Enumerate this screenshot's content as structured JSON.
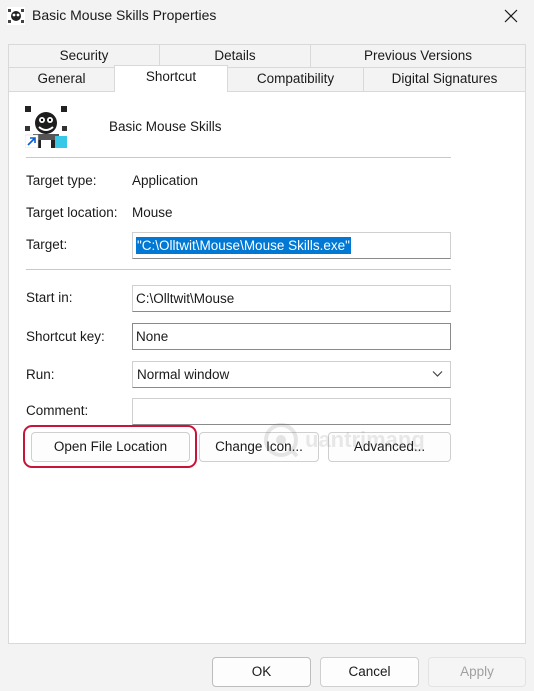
{
  "window": {
    "title": "Basic Mouse Skills Properties",
    "close_symbol": "✕"
  },
  "tabs": {
    "row1": [
      "Security",
      "Details",
      "Previous Versions"
    ],
    "row2": [
      "General",
      "Shortcut",
      "Compatibility",
      "Digital Signatures"
    ],
    "selected": "Shortcut"
  },
  "shortcut": {
    "name": "Basic Mouse Skills",
    "target_type_label": "Target type:",
    "target_type": "Application",
    "target_location_label": "Target location:",
    "target_location": "Mouse",
    "target_label": "Target:",
    "target_value": "\"C:\\Olltwit\\Mouse\\Mouse Skills.exe\"",
    "start_in_label": "Start in:",
    "start_in_value": "C:\\Olltwit\\Mouse",
    "shortcut_key_label": "Shortcut key:",
    "shortcut_key_value": "None",
    "run_label": "Run:",
    "run_value": "Normal window",
    "comment_label": "Comment:",
    "comment_value": ""
  },
  "buttons": {
    "open_file_location": "Open File Location",
    "change_icon": "Change Icon...",
    "advanced": "Advanced..."
  },
  "footer": {
    "ok": "OK",
    "cancel": "Cancel",
    "apply": "Apply"
  },
  "watermark": {
    "text": "uantrimang"
  },
  "colors": {
    "selection": "#0078d4",
    "highlight_ring": "#c8143a",
    "window_bg": "#f3f3f3",
    "panel_bg": "#ffffff"
  },
  "icons": [
    "app-icon",
    "close-icon",
    "shortcut-icon",
    "chevron-down-icon"
  ]
}
